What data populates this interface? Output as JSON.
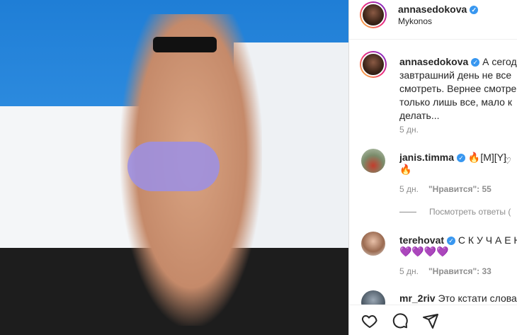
{
  "post": {
    "author": "annasedokova",
    "location": "Mykonos"
  },
  "caption": {
    "author": "annasedokova",
    "lines": [
      "А сегод",
      "завтрашний день не все",
      "смотреть. Вернее смотре",
      "только лишь все, мало к",
      "делать..."
    ],
    "age": "5 дн."
  },
  "comments": [
    {
      "user": "janis.timma",
      "text": "🔥[M][Y]",
      "text2": "🔥",
      "age": "5 дн.",
      "likes": "\"Нравится\": 55"
    },
    {
      "user": "terehovat",
      "text": "С К У Ч А Е Н",
      "text2": "💜💜💜💜",
      "age": "5 дн.",
      "likes": "\"Нравится\": 33"
    },
    {
      "user": "mr_2riv",
      "text": "Это кстати слова"
    }
  ],
  "replies_label": "Посмотреть ответы (",
  "icons": [
    "heart-icon",
    "comment-icon",
    "share-icon"
  ],
  "colors": {
    "verified": "#3897f0",
    "muted": "#8e8e8e",
    "text": "#262626"
  }
}
